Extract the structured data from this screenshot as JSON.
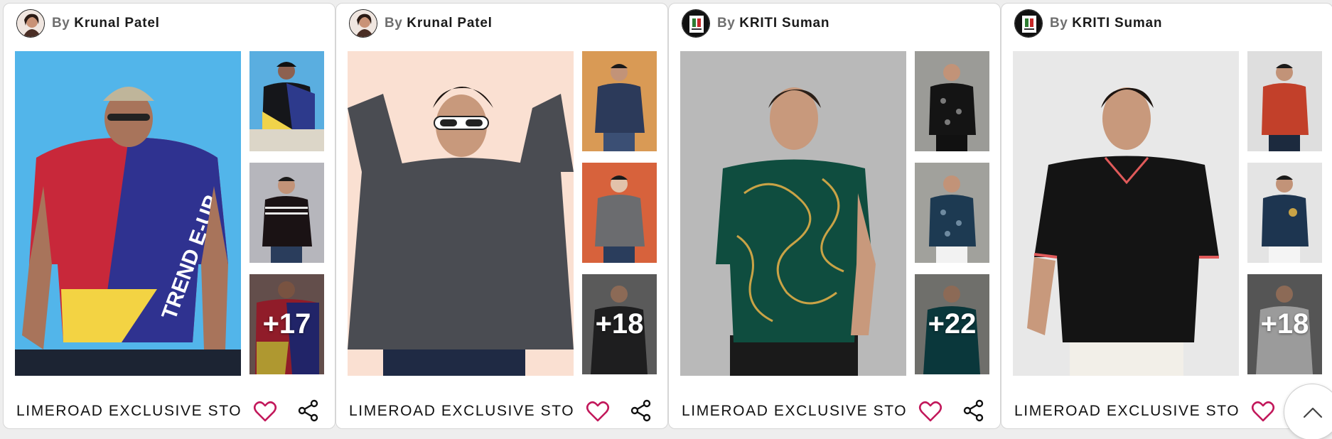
{
  "cards": [
    {
      "by": "By",
      "author": "Krunal Patel",
      "store": "LIMEROAD EXCLUSIVE STORE",
      "more_count": "+17",
      "avatar_icon": "woman-portrait-avatar",
      "heart_color": "#c2185b",
      "image_bg": "#52b5ea",
      "thumb_bgs": [
        "#5aaee0",
        "#b6b6bc",
        "#8a6c68"
      ]
    },
    {
      "by": "By",
      "author": "Krunal Patel",
      "store": "LIMEROAD EXCLUSIVE STORE",
      "more_count": "+18",
      "avatar_icon": "woman-portrait-avatar",
      "heart_color": "#c2185b",
      "image_bg": "#fae0d2",
      "thumb_bgs": [
        "#d99a55",
        "#d7623c",
        "#7d7d7d"
      ]
    },
    {
      "by": "By",
      "author": "KRITI Suman",
      "store": "LIMEROAD EXCLUSIVE STORE",
      "more_count": "+22",
      "avatar_icon": "store-logo-avatar",
      "heart_color": "#c2185b",
      "image_bg": "#b9b9b9",
      "thumb_bgs": [
        "#9b9b97",
        "#a1a19c",
        "#9a9a95"
      ]
    },
    {
      "by": "By",
      "author": "KRITI Suman",
      "store": "LIMEROAD EXCLUSIVE STORE",
      "more_count": "+18",
      "avatar_icon": "store-logo-avatar",
      "heart_color": "#c2185b",
      "image_bg": "#e8e8e8",
      "thumb_bgs": [
        "#dedede",
        "#e4e4e4",
        "#777777"
      ]
    }
  ],
  "scroll_top_icon": "chevron-up-icon"
}
